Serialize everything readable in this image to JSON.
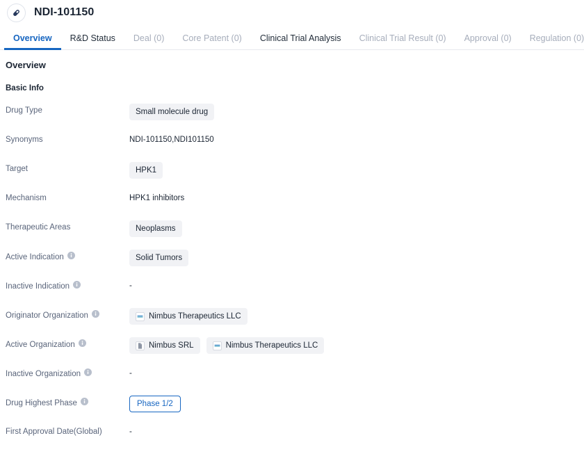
{
  "header": {
    "title": "NDI-101150",
    "avatar_icon": "pill-capsule-icon"
  },
  "tabs": [
    {
      "label": "Overview",
      "state": "active"
    },
    {
      "label": "R&D Status",
      "state": "normal"
    },
    {
      "label": "Deal (0)",
      "state": "disabled"
    },
    {
      "label": "Core Patent (0)",
      "state": "disabled"
    },
    {
      "label": "Clinical Trial Analysis",
      "state": "normal"
    },
    {
      "label": "Clinical Trial Result (0)",
      "state": "disabled"
    },
    {
      "label": "Approval (0)",
      "state": "disabled"
    },
    {
      "label": "Regulation (0)",
      "state": "disabled"
    }
  ],
  "overview": {
    "section_title": "Overview",
    "subsection_title": "Basic Info",
    "rows": [
      {
        "label": "Drug Type",
        "has_info": false,
        "type": "chips",
        "values": [
          "Small molecule drug"
        ]
      },
      {
        "label": "Synonyms",
        "has_info": false,
        "type": "text",
        "values": [
          "NDI-101150,NDI101150"
        ]
      },
      {
        "label": "Target",
        "has_info": false,
        "type": "chips",
        "values": [
          "HPK1"
        ]
      },
      {
        "label": "Mechanism",
        "has_info": false,
        "type": "text",
        "values": [
          "HPK1 inhibitors"
        ]
      },
      {
        "label": "Therapeutic Areas",
        "has_info": false,
        "type": "chips",
        "values": [
          "Neoplasms"
        ]
      },
      {
        "label": "Active Indication",
        "has_info": true,
        "type": "chips",
        "values": [
          "Solid Tumors"
        ]
      },
      {
        "label": "Inactive Indication",
        "has_info": true,
        "type": "text",
        "values": [
          "-"
        ]
      },
      {
        "label": "Originator Organization",
        "has_info": true,
        "type": "org-chips",
        "orgs": [
          {
            "name": "Nimbus Therapeutics LLC",
            "logo": "nimbus-stripes-logo-icon"
          }
        ]
      },
      {
        "label": "Active Organization",
        "has_info": true,
        "type": "org-chips",
        "orgs": [
          {
            "name": "Nimbus SRL",
            "logo": "document-page-logo-icon"
          },
          {
            "name": "Nimbus Therapeutics LLC",
            "logo": "nimbus-stripes-logo-icon"
          }
        ]
      },
      {
        "label": "Inactive Organization",
        "has_info": true,
        "type": "text",
        "values": [
          "-"
        ]
      },
      {
        "label": "Drug Highest Phase",
        "has_info": true,
        "type": "phase",
        "values": [
          "Phase 1/2"
        ]
      },
      {
        "label": "First Approval Date(Global)",
        "has_info": false,
        "type": "text",
        "values": [
          "-"
        ]
      }
    ]
  },
  "colors": {
    "accent": "#1766c1",
    "label": "#59647a",
    "text": "#1b2533",
    "chip_bg": "#f1f2f5",
    "disabled_tab": "#a6adbb"
  }
}
